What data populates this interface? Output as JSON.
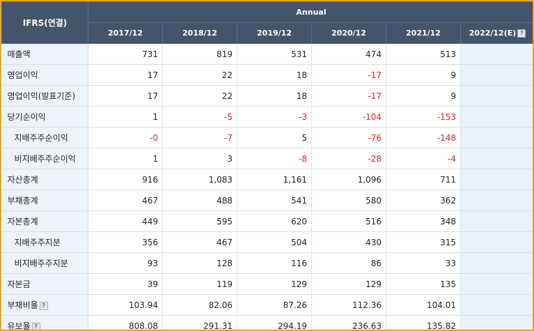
{
  "header": {
    "corner": "IFRS(연결)",
    "annual": "Annual",
    "years": [
      "2017/12",
      "2018/12",
      "2019/12",
      "2020/12",
      "2021/12",
      "2022/12(E)"
    ]
  },
  "rows": [
    {
      "label": "매출액",
      "sub": false,
      "help": false,
      "values": [
        "731",
        "819",
        "531",
        "474",
        "513",
        ""
      ]
    },
    {
      "label": "영업이익",
      "sub": false,
      "help": false,
      "values": [
        "17",
        "22",
        "18",
        "-17",
        "9",
        ""
      ]
    },
    {
      "label": "영업이익(발표기준)",
      "sub": false,
      "help": false,
      "values": [
        "17",
        "22",
        "18",
        "-17",
        "9",
        ""
      ]
    },
    {
      "label": "당기순이익",
      "sub": false,
      "help": false,
      "values": [
        "1",
        "-5",
        "-3",
        "-104",
        "-153",
        ""
      ]
    },
    {
      "label": "지배주주순이익",
      "sub": true,
      "help": false,
      "values": [
        "-0",
        "-7",
        "5",
        "-76",
        "-148",
        ""
      ]
    },
    {
      "label": "비지배주주순이익",
      "sub": true,
      "help": false,
      "values": [
        "1",
        "3",
        "-8",
        "-28",
        "-4",
        ""
      ]
    },
    {
      "label": "자산총계",
      "sub": false,
      "help": false,
      "values": [
        "916",
        "1,083",
        "1,161",
        "1,096",
        "711",
        ""
      ]
    },
    {
      "label": "부채총계",
      "sub": false,
      "help": false,
      "values": [
        "467",
        "488",
        "541",
        "580",
        "362",
        ""
      ]
    },
    {
      "label": "자본총계",
      "sub": false,
      "help": false,
      "values": [
        "449",
        "595",
        "620",
        "516",
        "348",
        ""
      ]
    },
    {
      "label": "지배주주지분",
      "sub": true,
      "help": false,
      "values": [
        "356",
        "467",
        "504",
        "430",
        "315",
        ""
      ]
    },
    {
      "label": "비지배주주지분",
      "sub": true,
      "help": false,
      "values": [
        "93",
        "128",
        "116",
        "86",
        "33",
        ""
      ]
    },
    {
      "label": "자본금",
      "sub": false,
      "help": false,
      "values": [
        "39",
        "119",
        "129",
        "129",
        "135",
        ""
      ]
    },
    {
      "label": "부채비율",
      "sub": false,
      "help": true,
      "values": [
        "103.94",
        "82.06",
        "87.26",
        "112.36",
        "104.01",
        ""
      ]
    },
    {
      "label": "유보율",
      "sub": false,
      "help": true,
      "values": [
        "808.08",
        "291.31",
        "294.19",
        "236.63",
        "135.82",
        ""
      ]
    }
  ],
  "colors": {
    "header": "#44546a",
    "negative": "#e02020",
    "estimate_bg": "#e6f3fb",
    "frame": "#f0a020"
  },
  "icons": {
    "help": "question-icon"
  }
}
